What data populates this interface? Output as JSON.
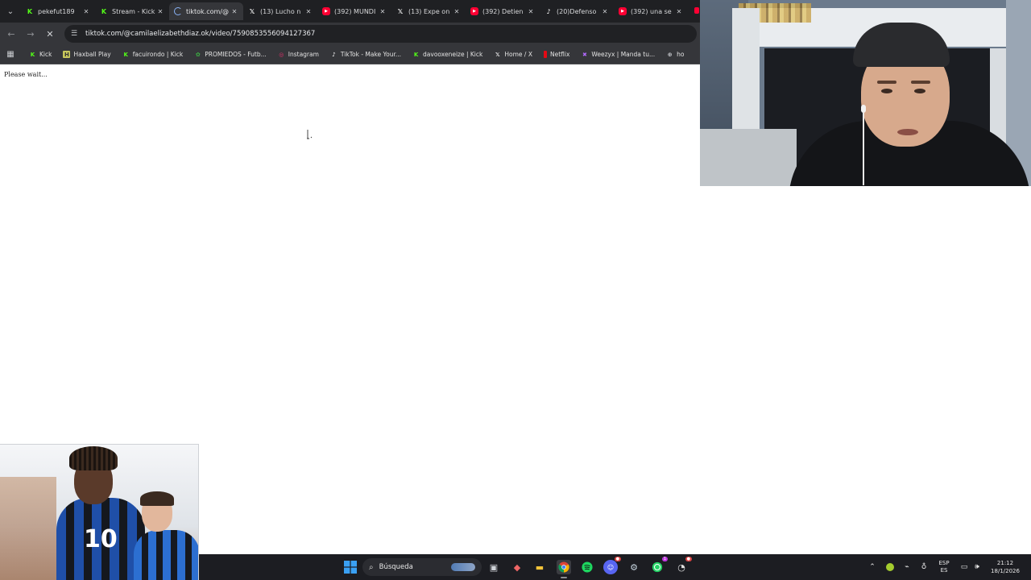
{
  "tabs": [
    {
      "title": "pekefut189",
      "favicon": "kick-icon",
      "active": false
    },
    {
      "title": "Stream - Kick",
      "favicon": "kick-icon",
      "active": false
    },
    {
      "title": "tiktok.com/@",
      "favicon": "loading-icon",
      "active": true
    },
    {
      "title": "(13) Lucho n",
      "favicon": "x-icon",
      "active": false
    },
    {
      "title": "(392) MUNDI",
      "favicon": "youtube-icon",
      "active": false
    },
    {
      "title": "(13) Expe on",
      "favicon": "x-icon",
      "active": false
    },
    {
      "title": "(392) Detien",
      "favicon": "youtube-icon",
      "active": false
    },
    {
      "title": "(20)Defenso",
      "favicon": "tiktok-icon",
      "active": false
    },
    {
      "title": "(392) una se",
      "favicon": "youtube-icon",
      "active": false
    }
  ],
  "address": {
    "url": "tiktok.com/@camilaelizabethdiaz.ok/video/7590853556094127367"
  },
  "bookmarks": [
    {
      "label": "Kick",
      "icon": "kick-icon"
    },
    {
      "label": "Haxball Play",
      "icon": "haxball-icon"
    },
    {
      "label": "facuirondo | Kick",
      "icon": "kick-icon"
    },
    {
      "label": "PROMIEDOS - Futb...",
      "icon": "promiedos-icon"
    },
    {
      "label": "Instagram",
      "icon": "instagram-icon"
    },
    {
      "label": "TikTok - Make Your...",
      "icon": "tiktok-icon"
    },
    {
      "label": "davooxeneize | Kick",
      "icon": "kick-icon"
    },
    {
      "label": "Home / X",
      "icon": "x-icon"
    },
    {
      "label": "Netflix",
      "icon": "netflix-icon"
    },
    {
      "label": "Weezyx | Manda tu...",
      "icon": "weezyx-icon"
    },
    {
      "label": "ho",
      "icon": "globe-icon"
    }
  ],
  "page": {
    "status_text": "Please wait..."
  },
  "thumbnail": {
    "jersey_number": "10"
  },
  "taskbar": {
    "search_label": "Búsqueda",
    "lang_top": "ESP",
    "lang_bottom": "ES",
    "time": "21:12",
    "date": "18/1/2026",
    "notification_badge": "1"
  },
  "colors": {
    "kick_green": "#53fc18",
    "chrome_dark": "#1f2023",
    "toolbar": "#35363a",
    "youtube_red": "#ff0033"
  }
}
